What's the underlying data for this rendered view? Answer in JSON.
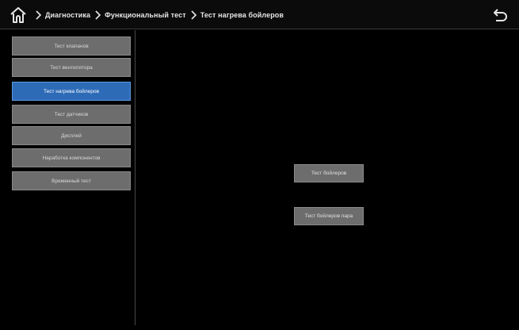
{
  "header": {
    "home_icon": "home-icon",
    "breadcrumbs": [
      "Диагностика",
      "Функциональный тест",
      "Тест нагрева бойлеров"
    ],
    "back_icon": "back-arrow-icon"
  },
  "sidebar": {
    "items": [
      {
        "label": "Тест клапанов",
        "active": false
      },
      {
        "label": "Тест вентилятора",
        "active": false
      },
      {
        "label": "Тест нагрева бойлеров",
        "active": true
      },
      {
        "label": "Тест датчиков",
        "active": false
      },
      {
        "label": "Дисплей",
        "active": false
      },
      {
        "label": "Наработка компонентов",
        "active": false
      },
      {
        "label": "Временный тест",
        "active": false
      }
    ]
  },
  "main": {
    "buttons": [
      {
        "label": "Тест бойлеров"
      },
      {
        "label": "Тест бойлеров пара"
      }
    ]
  },
  "colors": {
    "background": "#000000",
    "button": "#6d6d6d",
    "active_button": "#2d6bb7"
  }
}
